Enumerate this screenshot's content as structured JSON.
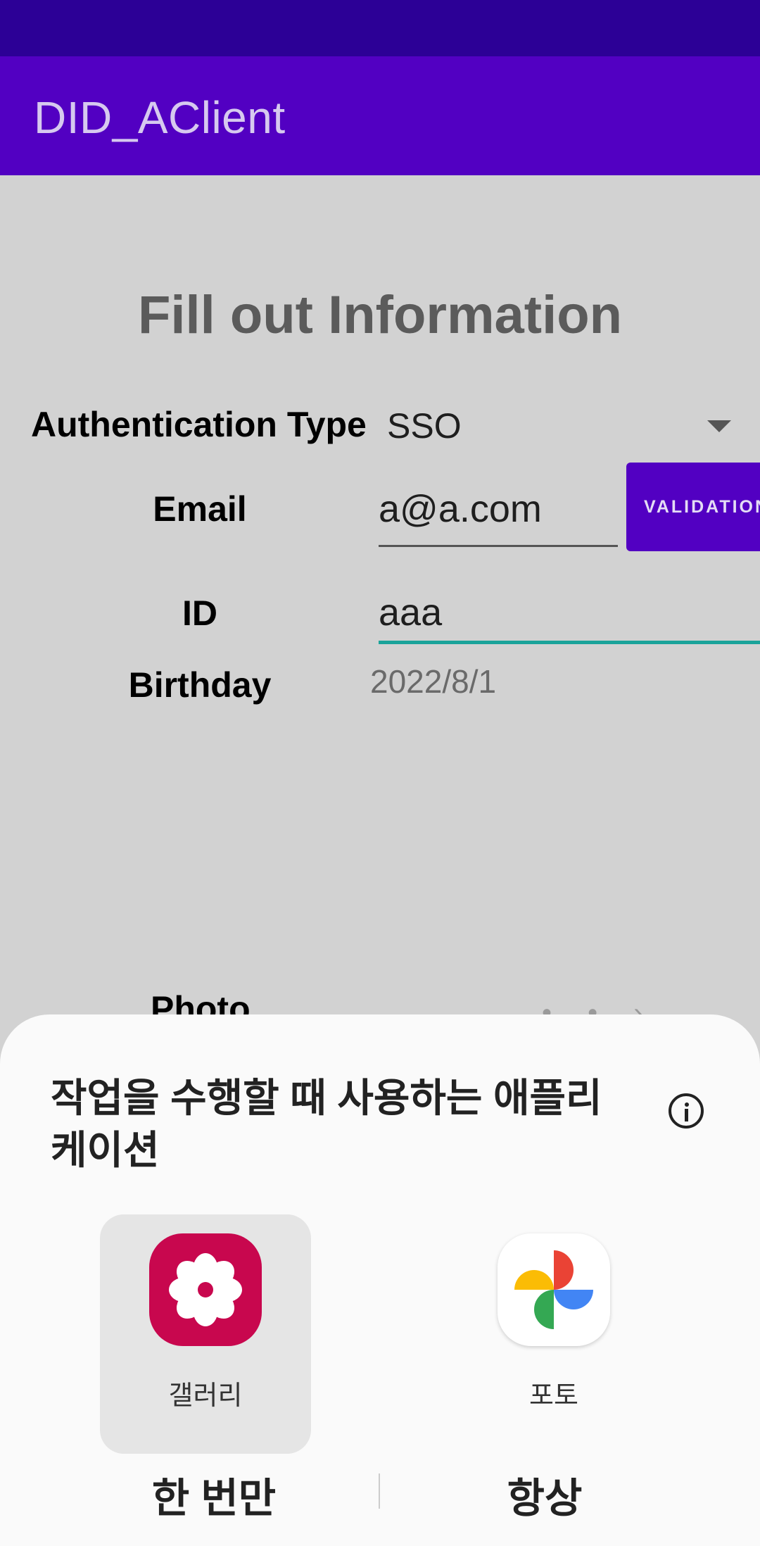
{
  "app": {
    "title": "DID_AClient"
  },
  "form": {
    "title": "Fill out Information",
    "auth_type_label": "Authentication Type",
    "auth_type_value": "SSO",
    "email_label": "Email",
    "email_value": "a@a.com",
    "validation_button": "VALIDATION",
    "id_label": "ID",
    "id_value": "aaa",
    "birthday_label": "Birthday",
    "birthday_value": "2022/8/1",
    "photo_label": "Photo"
  },
  "sheet": {
    "title": "작업을 수행할 때 사용하는 애플리케이션",
    "apps": [
      {
        "label": "갤러리",
        "icon": "samsung-gallery-icon",
        "selected": true,
        "color": "#c8074e"
      },
      {
        "label": "포토",
        "icon": "google-photos-icon",
        "selected": false
      }
    ],
    "just_once": "한 번만",
    "always": "항상"
  },
  "colors": {
    "status_bar": "#2c0096",
    "app_bar": "#5200c2",
    "accent": "#1aa39a"
  }
}
